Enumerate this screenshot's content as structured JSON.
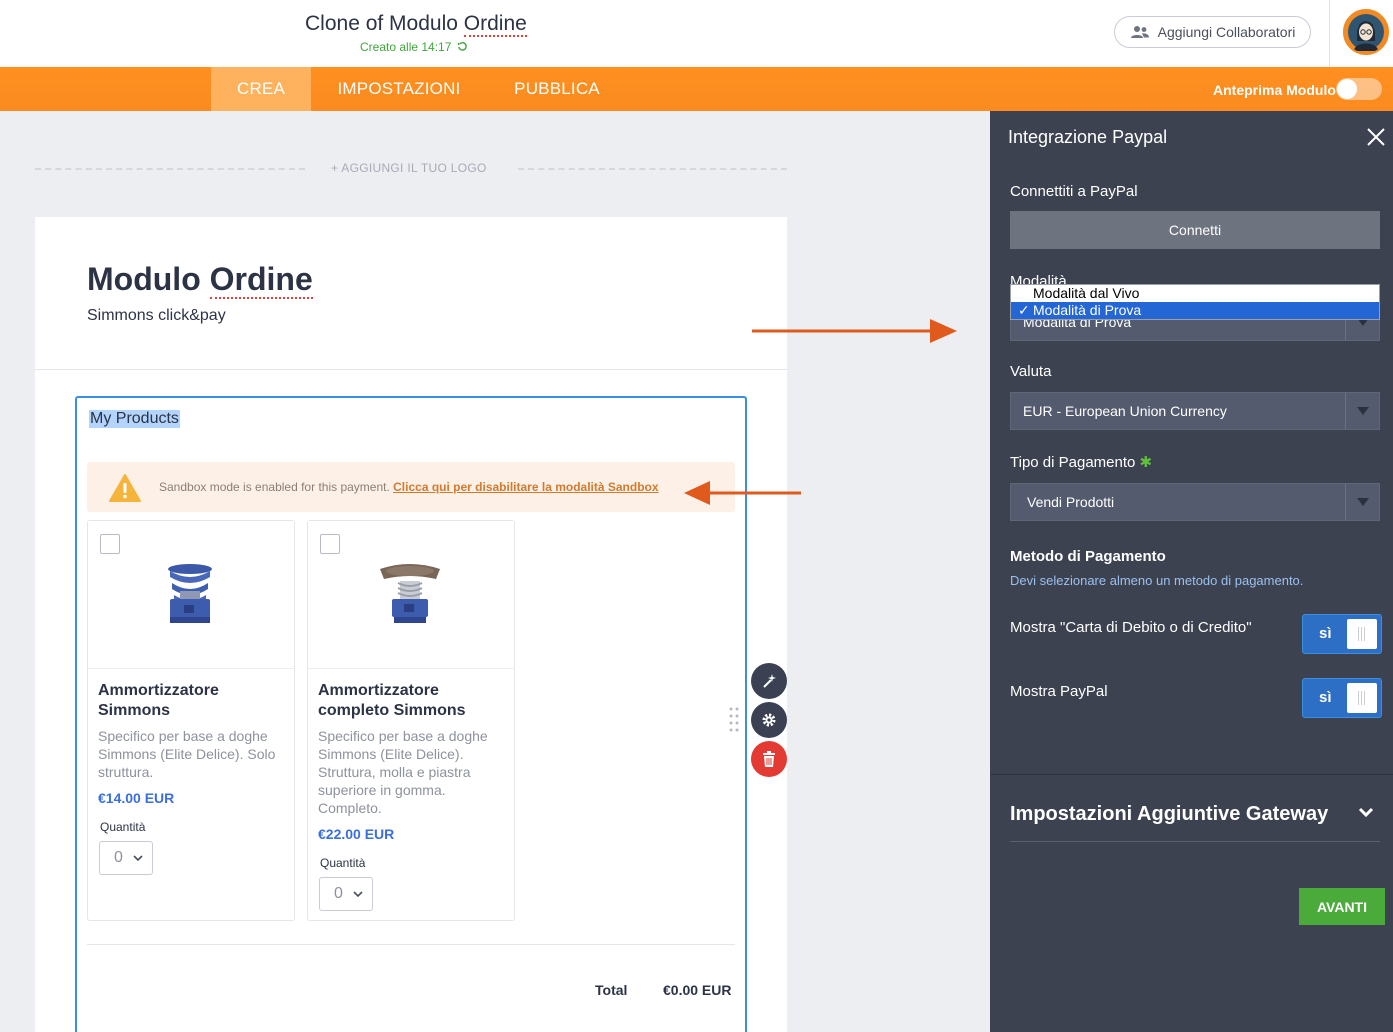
{
  "header": {
    "title_prefix": "Clone of Modulo ",
    "title_underlined": "Ordine",
    "subtitle": "Creato alle 14:17",
    "collab_label": "Aggiungi Collaboratori"
  },
  "nav": {
    "tabs": [
      {
        "label": "CREA",
        "active": true
      },
      {
        "label": "IMPOSTAZIONI",
        "active": false
      },
      {
        "label": "PUBBLICA",
        "active": false
      }
    ],
    "preview_label": "Anteprima Modulo",
    "preview_on": false
  },
  "logo_placeholder": "+ AGGIUNGI IL TUO LOGO",
  "form": {
    "title_prefix": "Modulo ",
    "title_underlined": "Ordine",
    "subtitle": "Simmons click&pay",
    "products_label": "My Products",
    "sandbox_text": "Sandbox mode is enabled for this payment. ",
    "sandbox_link": "Clicca qui per disabilitare la modalità Sandbox",
    "products": [
      {
        "name": "Ammortizzatore Simmons",
        "desc": "Specifico per base a doghe Simmons (Elite Delice). Solo struttura.",
        "price": "€14.00 EUR",
        "qty_label": "Quantità",
        "qty": "0"
      },
      {
        "name": "Ammortizzatore completo Simmons",
        "desc": "Specifico per base a doghe Simmons (Elite Delice). Struttura, molla e piastra superiore in gomma. Completo.",
        "price": "€22.00 EUR",
        "qty_label": "Quantità",
        "qty": "0"
      }
    ],
    "total_label": "Total",
    "total_value": "€0.00 EUR"
  },
  "panel": {
    "title": "Integrazione Paypal",
    "connect_label": "Connettiti a PayPal",
    "connect_button": "Connetti",
    "mode_label": "Modalità",
    "mode_options": [
      "Modalità dal Vivo",
      "Modalità di Prova"
    ],
    "mode_selected": "Modalità di Prova",
    "currency_label": "Valuta",
    "currency_value": "EUR - European Union Currency",
    "payment_type_label": "Tipo di Pagamento",
    "payment_type_value": "Vendi Prodotti",
    "method_title": "Metodo di Pagamento",
    "method_hint": "Devi selezionare almeno un metodo di pagamento.",
    "show_card_label": "Mostra \"Carta di Debito o di Credito\"",
    "show_card_toggle": "sì",
    "show_paypal_label": "Mostra PayPal",
    "show_paypal_toggle": "sì",
    "extra_section": "Impostazioni Aggiuntive Gateway",
    "next_button": "AVANTI"
  },
  "colors": {
    "orange": "#ff8f1f",
    "panel_bg": "#3c4250",
    "accent_blue": "#3a8fe0",
    "green": "#4bab3a",
    "arrow": "#e05a1e"
  }
}
